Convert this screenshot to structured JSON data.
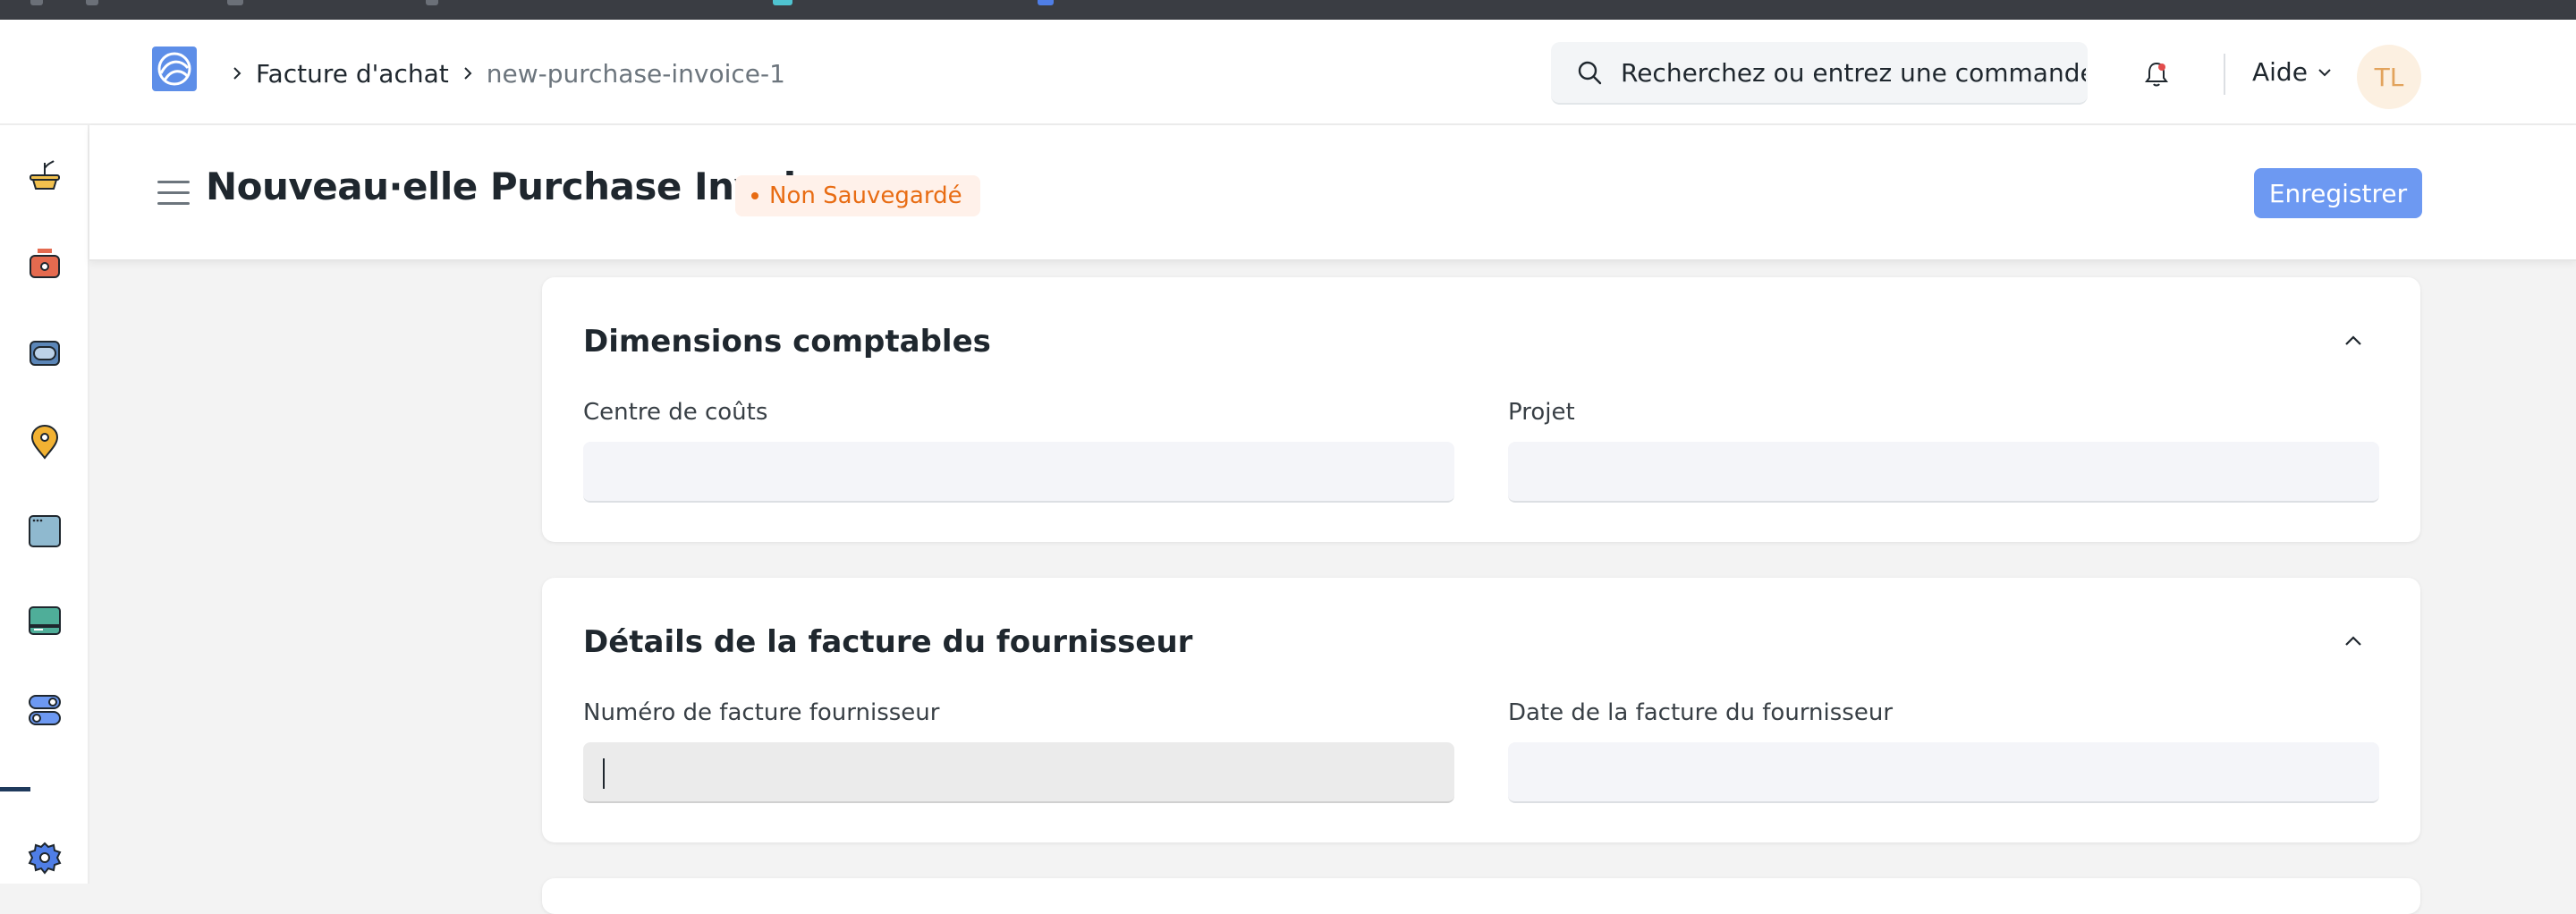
{
  "breadcrumb": {
    "items": [
      "Facture d'achat",
      "new-purchase-invoice-1"
    ]
  },
  "search": {
    "placeholder": "Recherchez ou entrez une commande"
  },
  "navbar": {
    "help_label": "Aide",
    "avatar_initials": "TL"
  },
  "page": {
    "title": "Nouveau·elle Purchase Invoice",
    "status": "Non Sauvegardé",
    "save_label": "Enregistrer"
  },
  "sections": [
    {
      "title": "Dimensions comptables",
      "fields": [
        {
          "label": "Centre de coûts",
          "value": ""
        },
        {
          "label": "Projet",
          "value": ""
        }
      ]
    },
    {
      "title": "Détails de la facture du fournisseur",
      "fields": [
        {
          "label": "Numéro de facture fournisseur",
          "value": ""
        },
        {
          "label": "Date de la facture du fournisseur",
          "value": ""
        }
      ]
    }
  ],
  "sidebar": {
    "icons": [
      "plant-icon",
      "cash-register-icon",
      "wallet-icon",
      "location-pin-icon",
      "browser-window-icon",
      "credit-card-icon",
      "toggle-icon",
      "settings-gear-icon"
    ]
  },
  "colors": {
    "accent": "#6d99f2",
    "status_orange": "#e86c13",
    "avatar_bg": "#fcf0e1"
  }
}
